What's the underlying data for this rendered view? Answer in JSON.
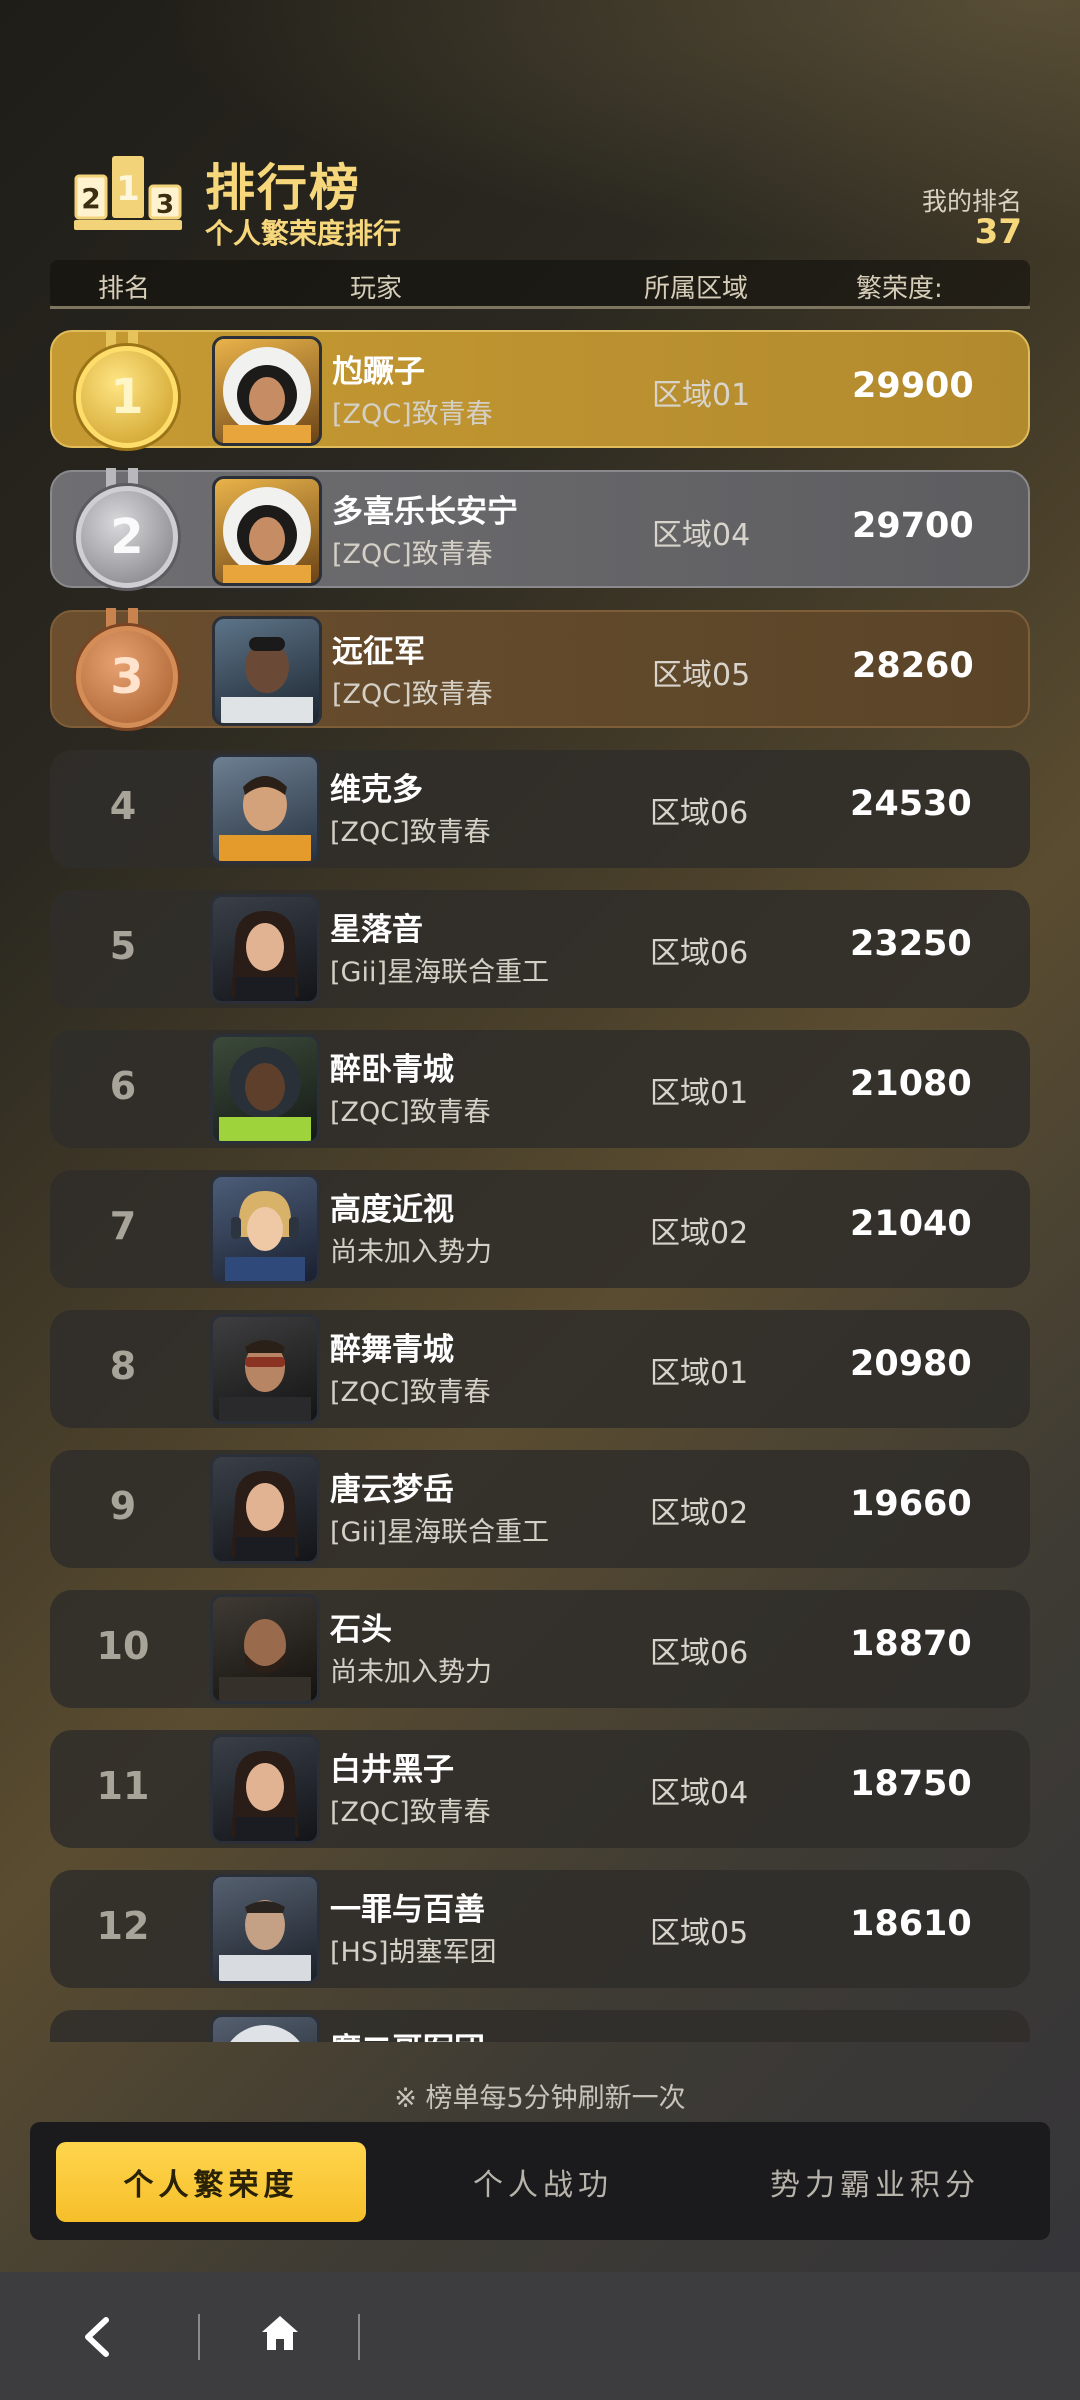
{
  "header": {
    "title": "排行榜",
    "subtitle": "个人繁荣度排行",
    "my_rank_label": "我的排名",
    "my_rank_value": "37",
    "icon": "podium-icon"
  },
  "table_header": {
    "rank": "排名",
    "player": "玩家",
    "region": "所属区域",
    "prosperity": "繁荣度:"
  },
  "rows": [
    {
      "rank": "1",
      "name": "尥蹶子",
      "guild": "[ZQC]致青春",
      "region": "区域01",
      "score": "29900",
      "medal": "gold"
    },
    {
      "rank": "2",
      "name": "多喜乐长安宁",
      "guild": "[ZQC]致青春",
      "region": "区域04",
      "score": "29700",
      "medal": "silver"
    },
    {
      "rank": "3",
      "name": "远征军",
      "guild": "[ZQC]致青春",
      "region": "区域05",
      "score": "28260",
      "medal": "bronze"
    },
    {
      "rank": "4",
      "name": "维克多",
      "guild": "[ZQC]致青春",
      "region": "区域06",
      "score": "24530"
    },
    {
      "rank": "5",
      "name": "星落音",
      "guild": "[Gii]星海联合重工",
      "region": "区域06",
      "score": "23250"
    },
    {
      "rank": "6",
      "name": "醉卧青城",
      "guild": "[ZQC]致青春",
      "region": "区域01",
      "score": "21080"
    },
    {
      "rank": "7",
      "name": "高度近视",
      "guild": "尚未加入势力",
      "region": "区域02",
      "score": "21040"
    },
    {
      "rank": "8",
      "name": "醉舞青城",
      "guild": "[ZQC]致青春",
      "region": "区域01",
      "score": "20980"
    },
    {
      "rank": "9",
      "name": "唐云梦岳",
      "guild": "[Gii]星海联合重工",
      "region": "区域02",
      "score": "19660"
    },
    {
      "rank": "10",
      "name": "石头",
      "guild": "尚未加入势力",
      "region": "区域06",
      "score": "18870"
    },
    {
      "rank": "11",
      "name": "白井黑子",
      "guild": "[ZQC]致青春",
      "region": "区域04",
      "score": "18750"
    },
    {
      "rank": "12",
      "name": "一罪与百善",
      "guild": "[HS]胡塞军团",
      "region": "区域05",
      "score": "18610"
    },
    {
      "rank": "13",
      "name": "魔二哥军团",
      "guild": "",
      "region": "",
      "score": ""
    }
  ],
  "footer_note": "※ 榜单每5分钟刷新一次",
  "tabs": [
    {
      "label": "个人繁荣度",
      "active": true
    },
    {
      "label": "个人战功",
      "active": false
    },
    {
      "label": "势力霸业积分",
      "active": false
    }
  ],
  "nav": {
    "back_icon": "back-arrow-icon",
    "home_icon": "home-icon"
  },
  "colors": {
    "accent_gold": "#f7d77b",
    "tab_active": "#ffd54d",
    "row_gold": "#c69a32",
    "row_silver": "#6f6f72",
    "row_bronze": "#6a4e2e",
    "row_default": "#302e2a"
  }
}
